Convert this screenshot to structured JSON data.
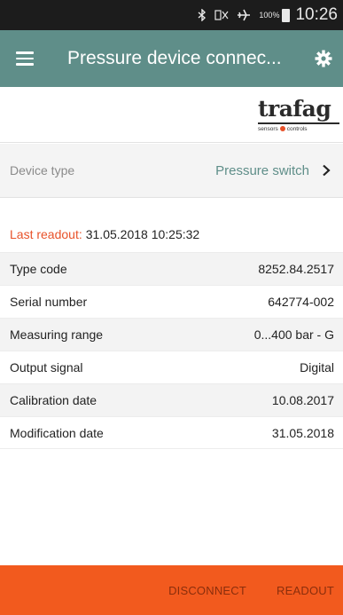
{
  "status_bar": {
    "battery_pct": "100%",
    "time": "10:26",
    "icons": [
      "bluetooth-icon",
      "no-sim-icon",
      "airplane-icon",
      "battery-icon"
    ]
  },
  "app_bar": {
    "title": "Pressure device connec...",
    "menu_icon": "hamburger-icon",
    "settings_icon": "gear-icon",
    "color": "#5f8e89"
  },
  "logo": {
    "word": "trafag",
    "tagline_left": "sensors",
    "tagline_right": "controls"
  },
  "device": {
    "label": "Device type",
    "value": "Pressure switch"
  },
  "last_readout": {
    "label": "Last readout:",
    "value": "31.05.2018 10:25:32"
  },
  "info_rows": [
    {
      "label": "Type code",
      "value": "8252.84.2517"
    },
    {
      "label": "Serial number",
      "value": "642774-002"
    },
    {
      "label": "Measuring range",
      "value": "0...400 bar - G"
    },
    {
      "label": "Output signal",
      "value": "Digital"
    },
    {
      "label": "Calibration date",
      "value": "10.08.2017"
    },
    {
      "label": "Modification date",
      "value": "31.05.2018"
    }
  ],
  "bottom_bar": {
    "disconnect": "DISCONNECT",
    "readout": "READOUT",
    "color": "#f25a1e"
  }
}
